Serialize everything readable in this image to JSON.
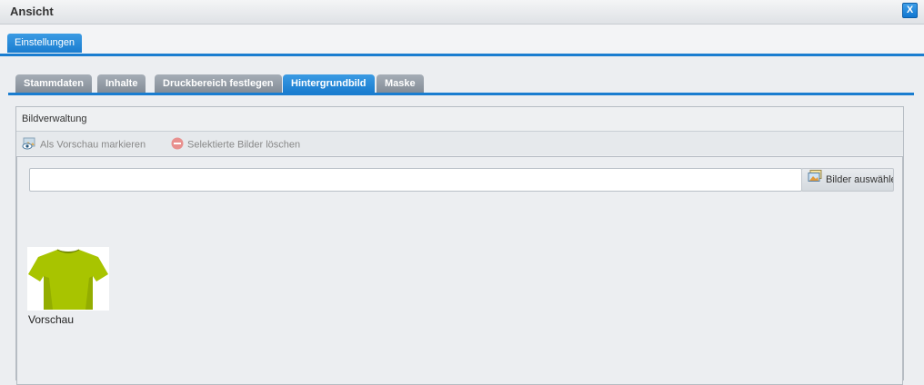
{
  "window": {
    "title": "Ansicht",
    "close_label": "X"
  },
  "top_tabs": [
    {
      "label": "Einstellungen",
      "active": true
    }
  ],
  "sub_tabs": [
    {
      "label": "Stammdaten",
      "active": false
    },
    {
      "label": "Inhalte",
      "active": false
    },
    {
      "label": "Druckbereich festlegen",
      "active": false
    },
    {
      "label": "Hintergrundbild",
      "active": true
    },
    {
      "label": "Maske",
      "active": false
    }
  ],
  "panel": {
    "title": "Bildverwaltung",
    "toolbar": {
      "mark_preview": {
        "label": "Als Vorschau markieren",
        "icon": "eye-image-icon"
      },
      "delete_selected": {
        "label": "Selektierte Bilder löschen",
        "icon": "minus-circle-icon"
      }
    },
    "file_input": {
      "value": "",
      "button_label": "Bilder auswählen",
      "button_icon": "image-icon"
    },
    "images": [
      {
        "label": "Vorschau",
        "depicts": "green t-shirt"
      }
    ]
  },
  "colors": {
    "accent": "#1a7dd0",
    "tab_inactive": "#8c949d",
    "tshirt": "#a8c400"
  }
}
